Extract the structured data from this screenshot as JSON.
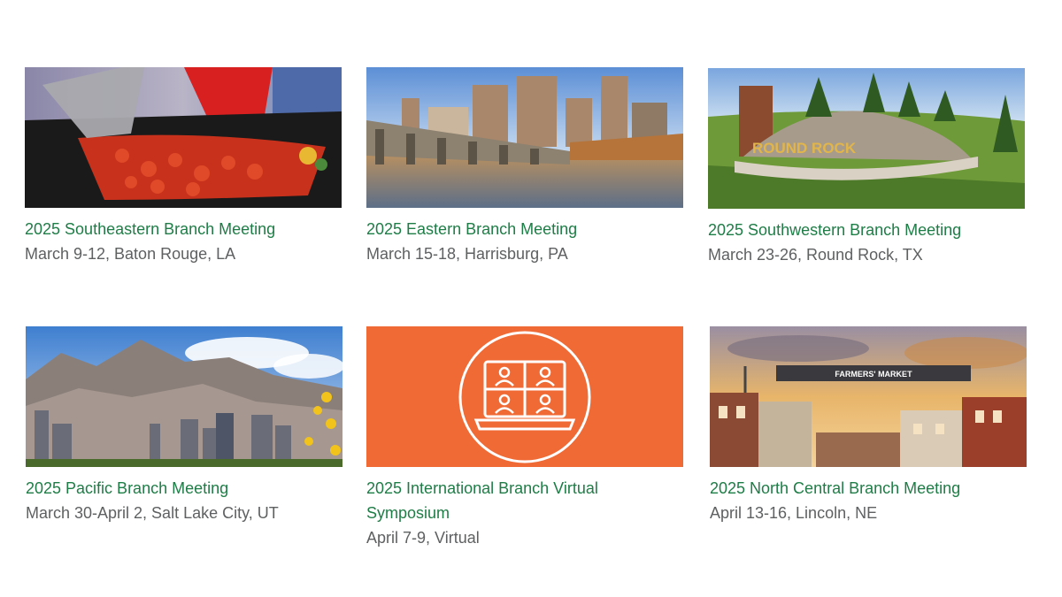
{
  "meetings": [
    {
      "title": "2025 Southeastern Branch Meeting",
      "details": "March 9-12, Baton Rouge, LA"
    },
    {
      "title": "2025 Eastern Branch Meeting",
      "details": "March 15-18, Harrisburg, PA"
    },
    {
      "title": "2025 Southwestern Branch Meeting",
      "details": "March 23-26, Round Rock, TX"
    },
    {
      "title": "2025 Pacific Branch Meeting",
      "details": "March 30-April 2, Salt Lake City, UT"
    },
    {
      "title": "2025 International Branch Virtual Symposium",
      "details": "April 7-9, Virtual"
    },
    {
      "title": "2025 North Central Branch Meeting",
      "details": "April 13-16, Lincoln, NE"
    }
  ],
  "image_labels": {
    "round_rock_sign": "ROUND ROCK",
    "farmers_market_banner": "FARMERS' MARKET"
  },
  "colors": {
    "title_green": "#1e7d46",
    "details_gray": "#5e6061",
    "virtual_orange": "#ef6a35"
  }
}
